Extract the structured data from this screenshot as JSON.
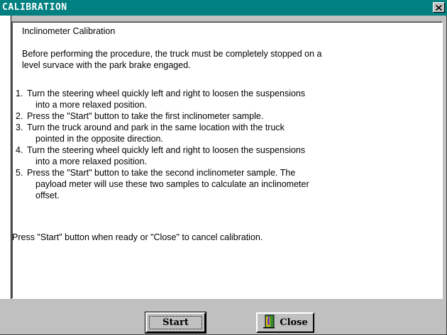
{
  "window": {
    "title": "CALIBRATION",
    "close_glyph": "✕"
  },
  "content": {
    "heading": "Inclinometer Calibration",
    "intro_line1": "Before performing the procedure, the truck must be completely stopped on a",
    "intro_line2": "level survace with the park brake engaged.",
    "steps": [
      {
        "num": "1.",
        "lines": [
          "Turn the steering wheel quickly left and right to loosen the suspensions",
          "into a more relaxed position."
        ]
      },
      {
        "num": "2.",
        "lines": [
          "Press the \"Start\" button to take the first inclinometer sample."
        ]
      },
      {
        "num": "3.",
        "lines": [
          "Turn the truck around and park in the same location with the truck",
          "pointed in the opposite direction."
        ]
      },
      {
        "num": "4.",
        "lines": [
          "Turn the steering wheel quickly left and right to loosen the suspensions",
          "into a more relaxed position."
        ]
      },
      {
        "num": "5.",
        "lines": [
          "Press the \"Start\" button to take the second inclinometer sample. The",
          "payload meter will use these two samples to calculate an inclinometer",
          "offset."
        ]
      }
    ],
    "footer": "Press \"Start\" button when ready or \"Close\" to cancel calibration."
  },
  "buttons": {
    "start_label": "Start",
    "close_label": "Close",
    "close_icon": "exit-door-icon"
  },
  "colors": {
    "titlebar": "#008080",
    "face": "#c0c0c0",
    "door_green": "#2e8b2e",
    "door_purple": "#6a3fb5",
    "door_yellow": "#e8c800"
  }
}
